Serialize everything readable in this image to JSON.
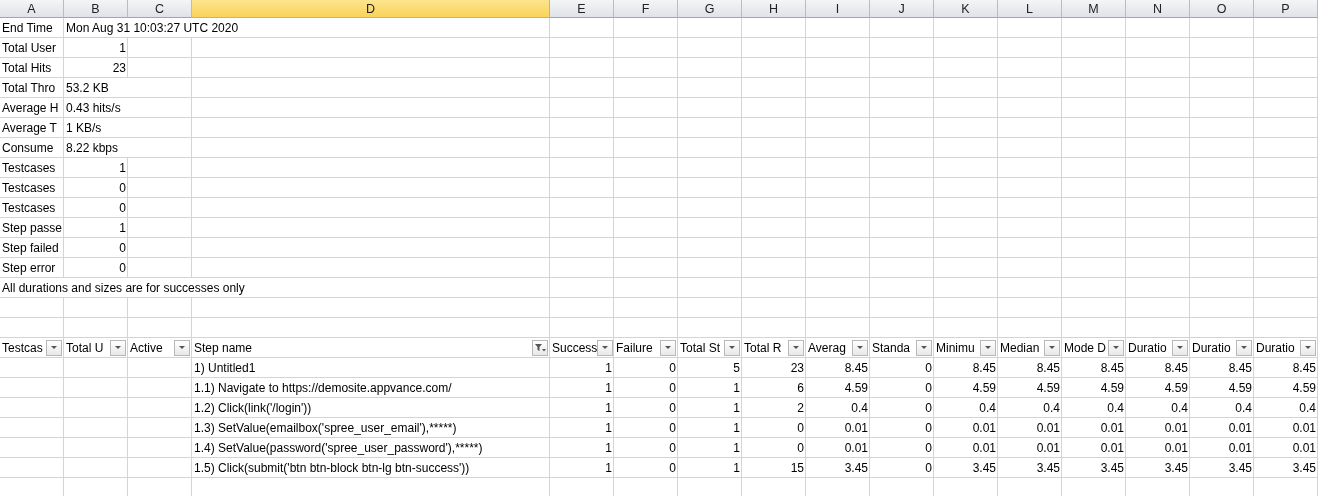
{
  "column_headers": [
    {
      "label": "A",
      "selected": false
    },
    {
      "label": "B",
      "selected": false
    },
    {
      "label": "C",
      "selected": false
    },
    {
      "label": "D",
      "selected": true
    },
    {
      "label": "E",
      "selected": false
    },
    {
      "label": "F",
      "selected": false
    },
    {
      "label": "G",
      "selected": false
    },
    {
      "label": "H",
      "selected": false
    },
    {
      "label": "I",
      "selected": false
    },
    {
      "label": "J",
      "selected": false
    },
    {
      "label": "K",
      "selected": false
    },
    {
      "label": "L",
      "selected": false
    },
    {
      "label": "M",
      "selected": false
    },
    {
      "label": "N",
      "selected": false
    },
    {
      "label": "O",
      "selected": false
    },
    {
      "label": "P",
      "selected": false
    }
  ],
  "end_time": {
    "label": "End Time",
    "value": "Mon Aug 31 10:03:27 UTC 2020"
  },
  "summary": [
    {
      "label": "Total User",
      "value": "1",
      "kind": "number"
    },
    {
      "label": "Total Hits",
      "value": "23",
      "kind": "number"
    },
    {
      "label": "Total Thro",
      "value": "53.2 KB",
      "kind": "text"
    },
    {
      "label": "Average H",
      "value": "0.43 hits/s",
      "kind": "text"
    },
    {
      "label": "Average T",
      "value": "1 KB/s",
      "kind": "text"
    },
    {
      "label": "Consume",
      "value": "8.22 kbps",
      "kind": "text"
    },
    {
      "label": "Testcases",
      "value": "1",
      "kind": "number"
    },
    {
      "label": "Testcases",
      "value": "0",
      "kind": "number"
    },
    {
      "label": "Testcases",
      "value": "0",
      "kind": "number"
    },
    {
      "label": "Step passe",
      "value": "1",
      "kind": "number"
    },
    {
      "label": "Step failed",
      "value": "0",
      "kind": "number"
    },
    {
      "label": "Step error",
      "value": "0",
      "kind": "number"
    }
  ],
  "note": "All durations and sizes are for successes only",
  "table": {
    "columns": [
      {
        "label": "Testcas",
        "filtered": false
      },
      {
        "label": "Total U",
        "filtered": false
      },
      {
        "label": "Active",
        "filtered": false
      },
      {
        "label": "Step name",
        "filtered": true
      },
      {
        "label": "Success",
        "filtered": false
      },
      {
        "label": "Failure",
        "filtered": false
      },
      {
        "label": "Total St",
        "filtered": false
      },
      {
        "label": "Total R",
        "filtered": false
      },
      {
        "label": "Averag",
        "filtered": false
      },
      {
        "label": "Standa",
        "filtered": false
      },
      {
        "label": "Minimu",
        "filtered": false
      },
      {
        "label": "Median",
        "filtered": false
      },
      {
        "label": "Mode D",
        "filtered": false
      },
      {
        "label": "Duratio",
        "filtered": false
      },
      {
        "label": "Duratio",
        "filtered": false
      },
      {
        "label": "Duratio",
        "filtered": false
      }
    ],
    "rows": [
      {
        "step": "1) Untitled1",
        "values": [
          "1",
          "0",
          "5",
          "23",
          "8.45",
          "0",
          "8.45",
          "8.45",
          "8.45",
          "8.45",
          "8.45",
          "8.45"
        ]
      },
      {
        "step": "1.1) Navigate to https://demosite.appvance.com/",
        "values": [
          "1",
          "0",
          "1",
          "6",
          "4.59",
          "0",
          "4.59",
          "4.59",
          "4.59",
          "4.59",
          "4.59",
          "4.59"
        ]
      },
      {
        "step": "1.2) Click(link('/login'))",
        "values": [
          "1",
          "0",
          "1",
          "2",
          "0.4",
          "0",
          "0.4",
          "0.4",
          "0.4",
          "0.4",
          "0.4",
          "0.4"
        ]
      },
      {
        "step": "1.3) SetValue(emailbox('spree_user_email'),*****)",
        "values": [
          "1",
          "0",
          "1",
          "0",
          "0.01",
          "0",
          "0.01",
          "0.01",
          "0.01",
          "0.01",
          "0.01",
          "0.01"
        ]
      },
      {
        "step": "1.4) SetValue(password('spree_user_password'),*****)",
        "values": [
          "1",
          "0",
          "1",
          "0",
          "0.01",
          "0",
          "0.01",
          "0.01",
          "0.01",
          "0.01",
          "0.01",
          "0.01"
        ]
      },
      {
        "step": "1.5) Click(submit('btn btn-block btn-lg btn-success'))",
        "values": [
          "1",
          "0",
          "1",
          "15",
          "3.45",
          "0",
          "3.45",
          "3.45",
          "3.45",
          "3.45",
          "3.45",
          "3.45"
        ]
      }
    ]
  }
}
